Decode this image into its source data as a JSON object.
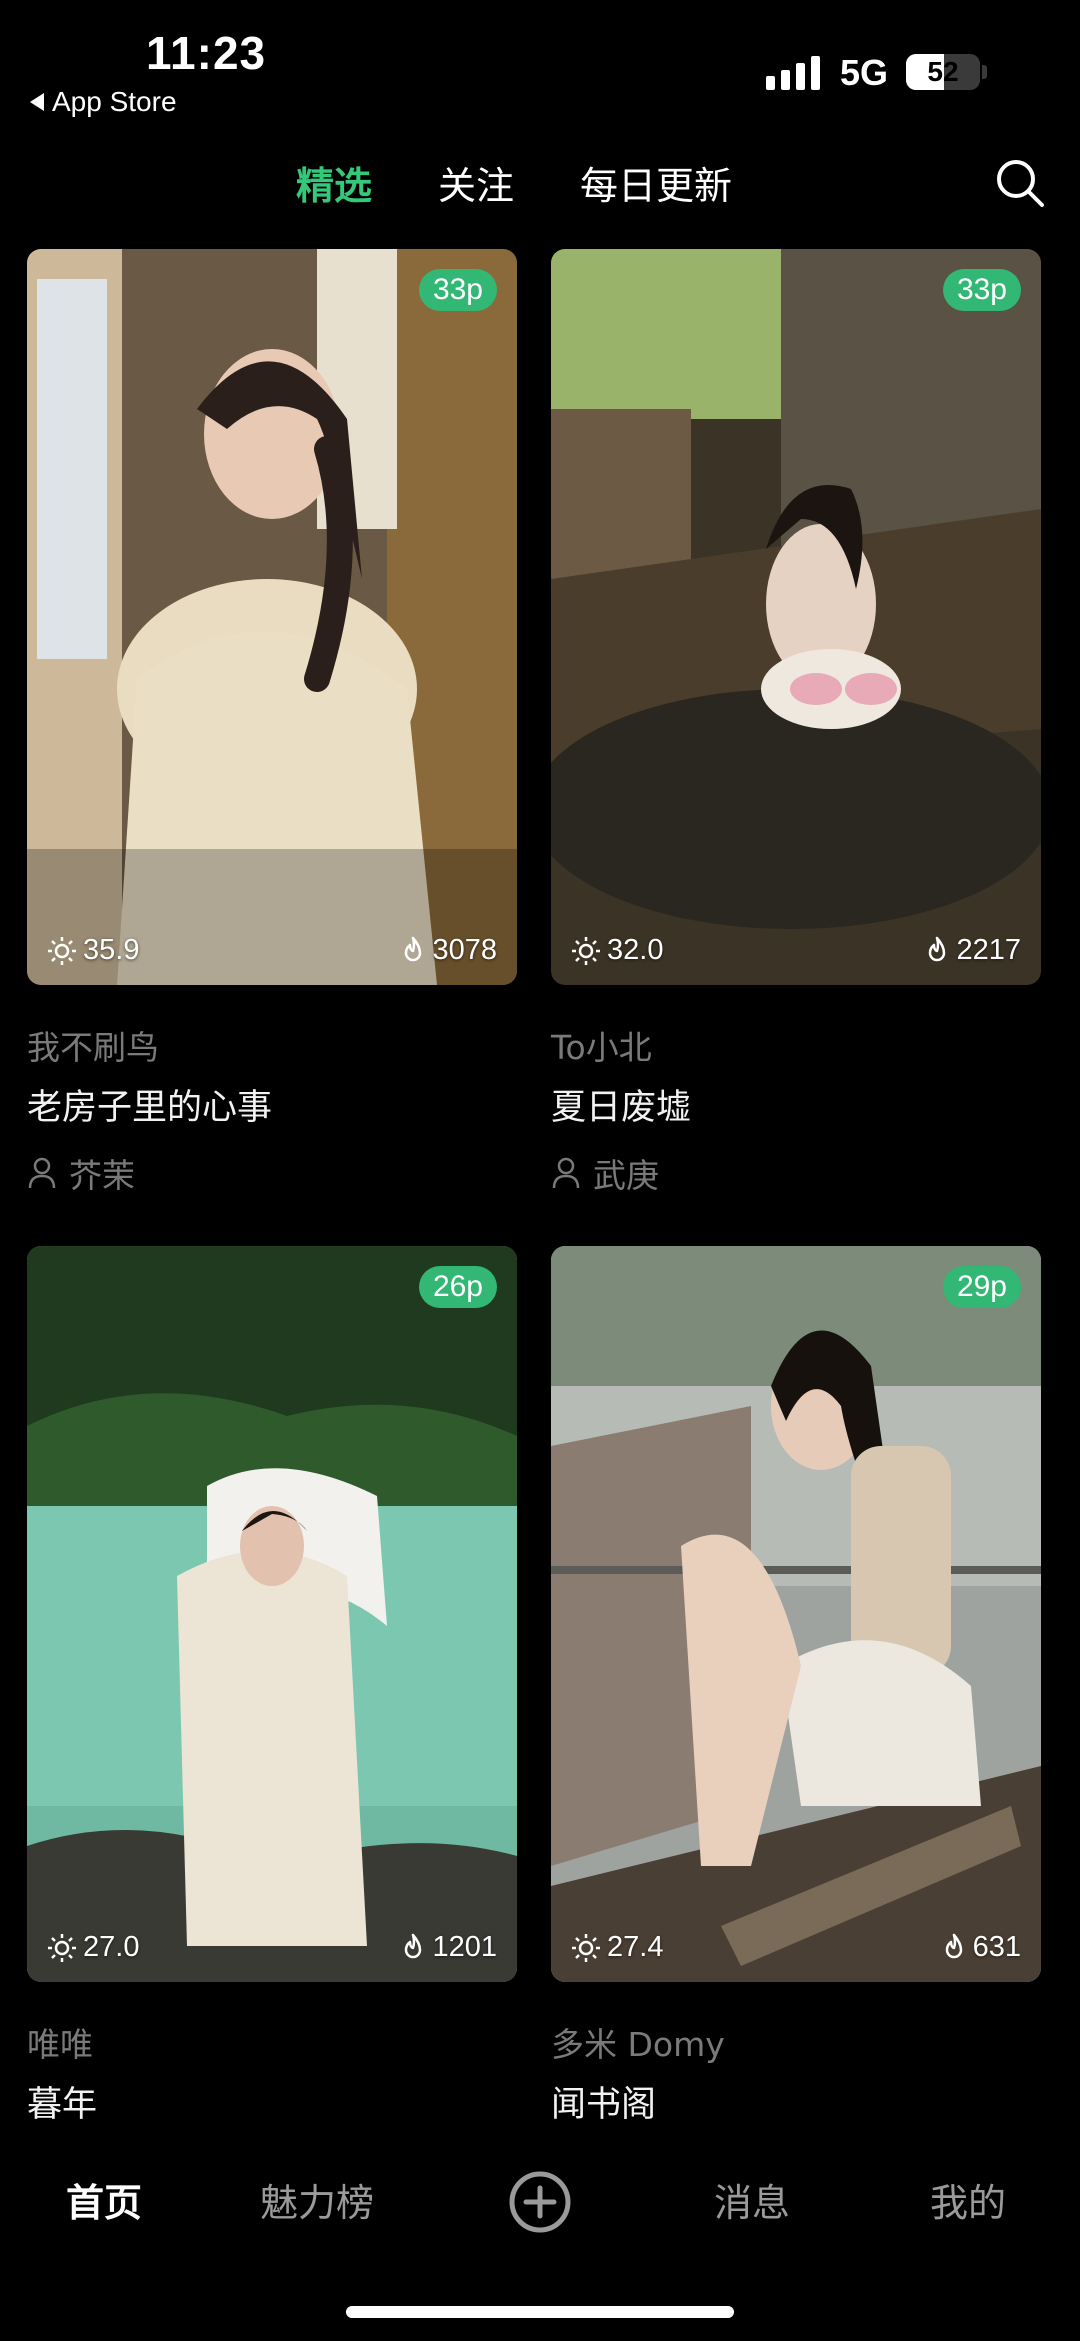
{
  "status_bar": {
    "time": "11:23",
    "back_app": "App Store",
    "network": "5G",
    "battery": "52",
    "battery_level": 0.52
  },
  "top_tabs": [
    {
      "label": "精选",
      "active": true
    },
    {
      "label": "关注"
    },
    {
      "label": "每日更新"
    }
  ],
  "cards": [
    {
      "badge": "33p",
      "score": "35.9",
      "heat": "3078",
      "author": "我不刷鸟",
      "title": "老房子里的心事",
      "model": "芥茉"
    },
    {
      "badge": "33p",
      "score": "32.0",
      "heat": "2217",
      "author": "To小北",
      "title": "夏日废墟",
      "model": "武庚"
    },
    {
      "badge": "26p",
      "score": "27.0",
      "heat": "1201",
      "author": "唯唯",
      "title": "暮年"
    },
    {
      "badge": "29p",
      "score": "27.4",
      "heat": "631",
      "author": "多米 Domy",
      "title": "闻书阁"
    }
  ],
  "bottom_nav": [
    {
      "label": "首页",
      "active": true
    },
    {
      "label": "魅力榜"
    },
    {
      "label": "消息"
    },
    {
      "label": "我的"
    }
  ],
  "colors": {
    "accent": "#35c77a",
    "badge": "#32b874",
    "muted": "#7a7a7a"
  }
}
